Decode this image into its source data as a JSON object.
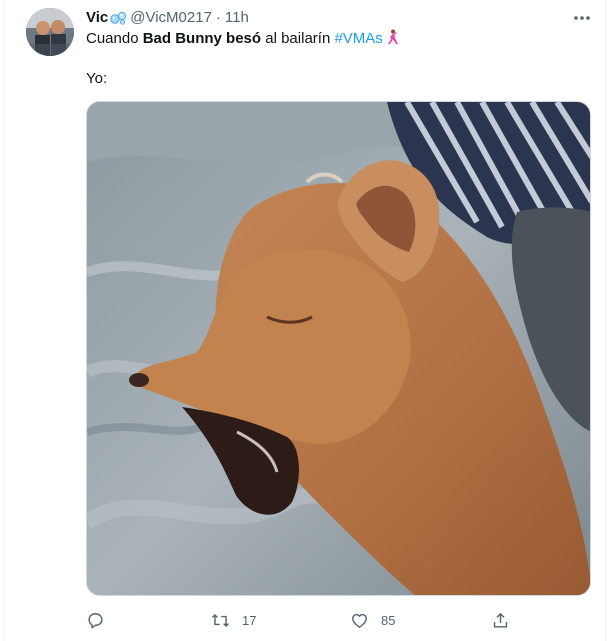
{
  "tweet": {
    "author_name": "Vic",
    "handle": "@VicM0217",
    "separator": "·",
    "time": "11h",
    "text_prefix": "Cuando ",
    "text_bold": "Bad Bunny besó",
    "text_middle": " al bailarín ",
    "hashtag": "#VMAs",
    "second_line": "Yo:",
    "name_emoji": "bubbles-emoji",
    "trailing_emoji": "dancing-person-emoji",
    "media_description_icon": "photo"
  },
  "actions": {
    "reply_icon": "reply-icon",
    "retweet_icon": "retweet-icon",
    "retweet_count": "17",
    "like_icon": "heart-icon",
    "like_count": "85",
    "share_icon": "share-icon"
  },
  "colors": {
    "accent": "#1d9bf0",
    "text": "#0f1419",
    "muted": "#536471",
    "border": "#cfd9de"
  }
}
